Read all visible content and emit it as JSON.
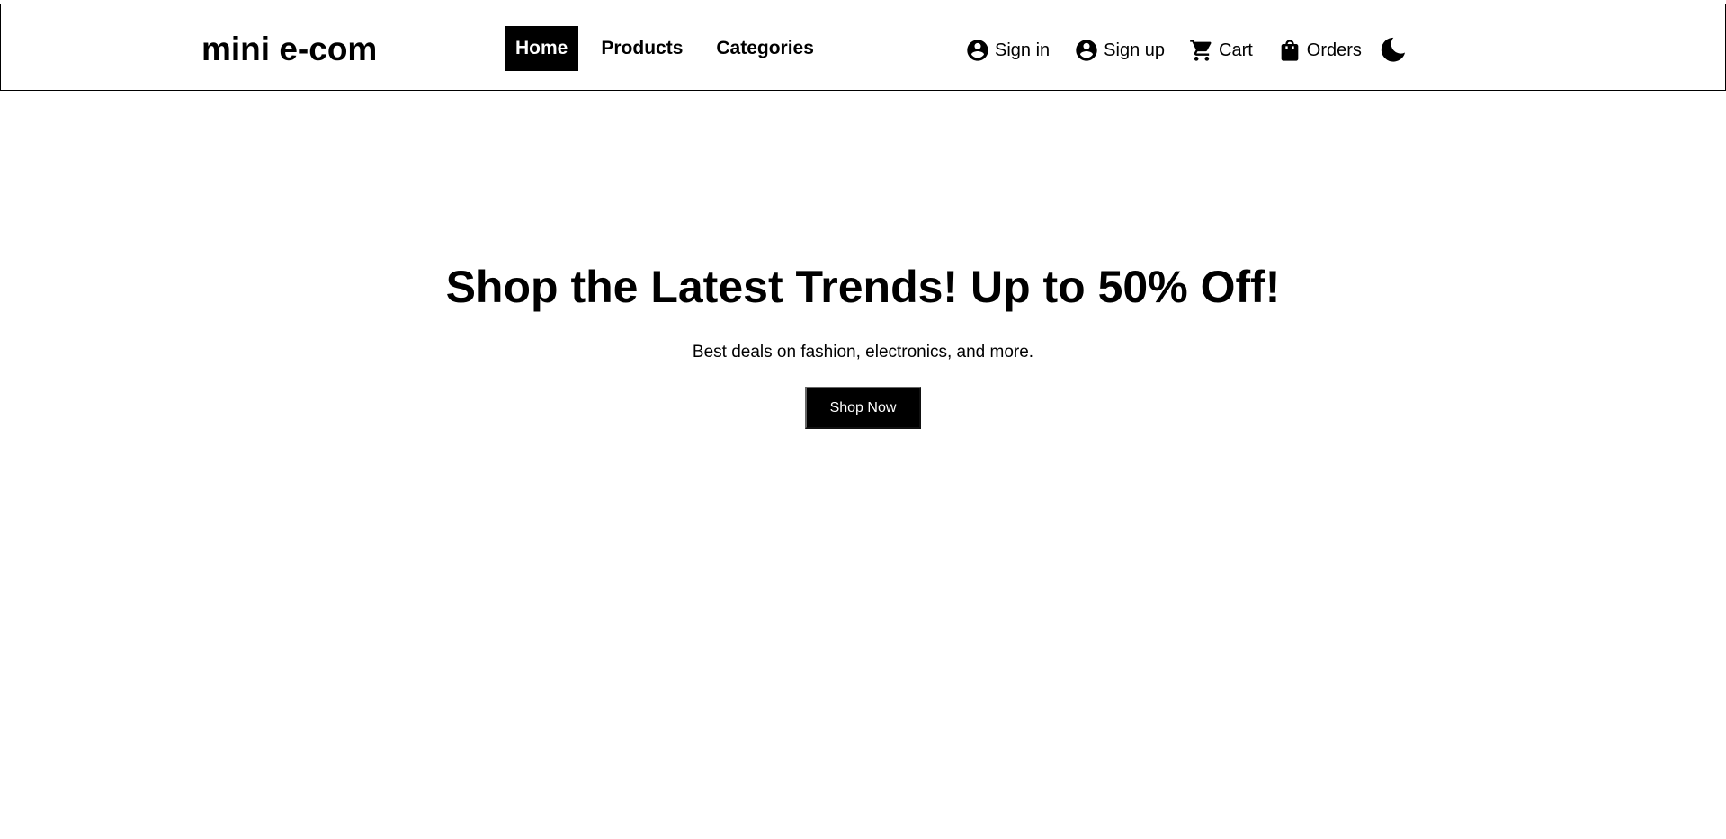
{
  "header": {
    "brand": "mini e-com",
    "nav": [
      {
        "label": "Home",
        "active": true
      },
      {
        "label": "Products",
        "active": false
      },
      {
        "label": "Categories",
        "active": false
      }
    ],
    "actions": [
      {
        "label": "Sign in",
        "icon": "account-circle-icon"
      },
      {
        "label": "Sign up",
        "icon": "account-circle-icon"
      },
      {
        "label": "Cart",
        "icon": "cart-icon"
      },
      {
        "label": "Orders",
        "icon": "shopping-bag-icon"
      }
    ],
    "theme_toggle_icon": "moon-icon"
  },
  "hero": {
    "title": "Shop the Latest Trends! Up to 50% Off!",
    "subtitle": "Best deals on fashion, electronics, and more.",
    "cta_label": "Shop Now"
  },
  "colors": {
    "background": "#ffffff",
    "text": "#000000",
    "active_nav_bg": "#000000",
    "active_nav_text": "#ffffff",
    "button_bg": "#000000",
    "button_text": "#ffffff"
  }
}
